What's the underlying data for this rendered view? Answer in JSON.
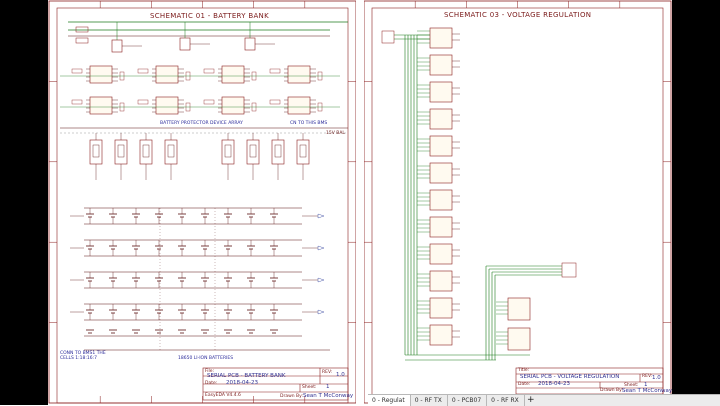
{
  "left_sheet": {
    "title": "SCHEMATIC 01 - BATTERY BANK",
    "bus_label_top": "BATTERY PROTECTOR DEVICE ARRAY",
    "bus_label_right": "CN TO THIS BMS",
    "bus_label_bank": "15V BAL",
    "cells_caption": "18650 LI-ION BATTERIES",
    "conn_label": "CONN TO BMS1 THE CELLS 1:18:16:7",
    "title_block": {
      "file_label": "File:",
      "file_value": "SERIAL PCB - BATTERY BANK",
      "rev_label": "REV:",
      "rev_value": "1.0",
      "date_label": "Date:",
      "date_value": "2018-04-23",
      "sheet_label": "Sheet:",
      "sheet_value": "1",
      "tool_value": "EasyEDA V4.4.6",
      "drawn_label": "Drawn By:",
      "drawn_value": "Sean T McConway"
    }
  },
  "right_sheet": {
    "title": "SCHEMATIC 03 - VOLTAGE REGULATION",
    "title_block": {
      "file_label": "Title:",
      "file_value": "SERIAL PCB - VOLTAGE REGULATION",
      "rev_label": "REV:",
      "rev_value": "1.0",
      "date_label": "Date:",
      "date_value": "2018-04-23",
      "sheet_label": "Sheet:",
      "sheet_value": "1",
      "drawn_label": "Drawn By:",
      "drawn_value": "Sean T McConway"
    }
  },
  "tabs": [
    {
      "label": "0 - Regulat"
    },
    {
      "label": "0 - RF TX"
    },
    {
      "label": "0 - PCB07"
    },
    {
      "label": "0 - RF RX"
    }
  ],
  "add_tab_label": "+"
}
